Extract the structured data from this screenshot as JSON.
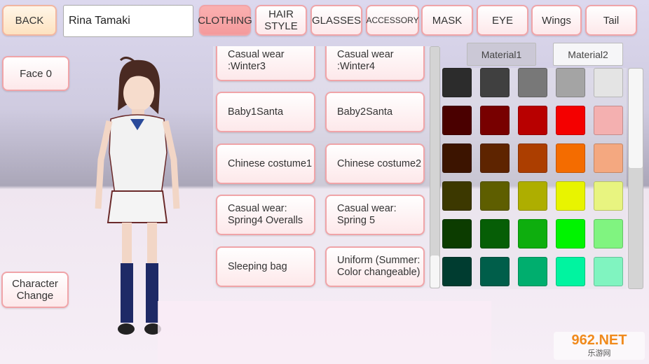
{
  "header": {
    "back_label": "BACK",
    "character_name": "Rina Tamaki",
    "tabs": [
      {
        "label": "CLOTHING",
        "active": true
      },
      {
        "label": "HAIR\nSTYLE"
      },
      {
        "label": "GLASSES"
      },
      {
        "label": "ACCESSORY"
      },
      {
        "label": "MASK"
      },
      {
        "label": "EYE"
      },
      {
        "label": "Wings"
      },
      {
        "label": "Tail"
      }
    ]
  },
  "left": {
    "face_label": "Face 0",
    "character_change_label": "Character\nChange"
  },
  "clothing_list": [
    "Casual wear\n:Winter3",
    "Casual wear\n:Winter4",
    "Baby1Santa",
    "Baby2Santa",
    "Chinese costume1",
    "Chinese costume2",
    "Casual wear:\nSpring4 Overalls",
    "Casual wear:\nSpring 5",
    "Sleeping bag",
    "Uniform (Summer:\nColor changeable)"
  ],
  "clothing_scroll_position": 1.0,
  "materials": {
    "material1_label": "Material1",
    "material2_label": "Material2",
    "selected": "Material2"
  },
  "palette": [
    [
      "#2c2c2c",
      "#404040",
      "#787878",
      "#a4a4a4",
      "#e4e4e4"
    ],
    [
      "#4a0000",
      "#780000",
      "#b80000",
      "#f40000",
      "#f4b0b0"
    ],
    [
      "#3c1400",
      "#5e2400",
      "#ac3e00",
      "#f46c00",
      "#f4a880"
    ],
    [
      "#3c3800",
      "#5e5e00",
      "#aeae00",
      "#e8f400",
      "#e8f480"
    ],
    [
      "#0c3c00",
      "#065e06",
      "#0eae0e",
      "#00f400",
      "#80f480"
    ],
    [
      "#003c30",
      "#005e4a",
      "#00ae6e",
      "#00f4a0",
      "#80f4c0"
    ]
  ],
  "palette_scroll_position": 0.0,
  "watermark": {
    "text": "962.NET",
    "subtext": "乐游网"
  }
}
